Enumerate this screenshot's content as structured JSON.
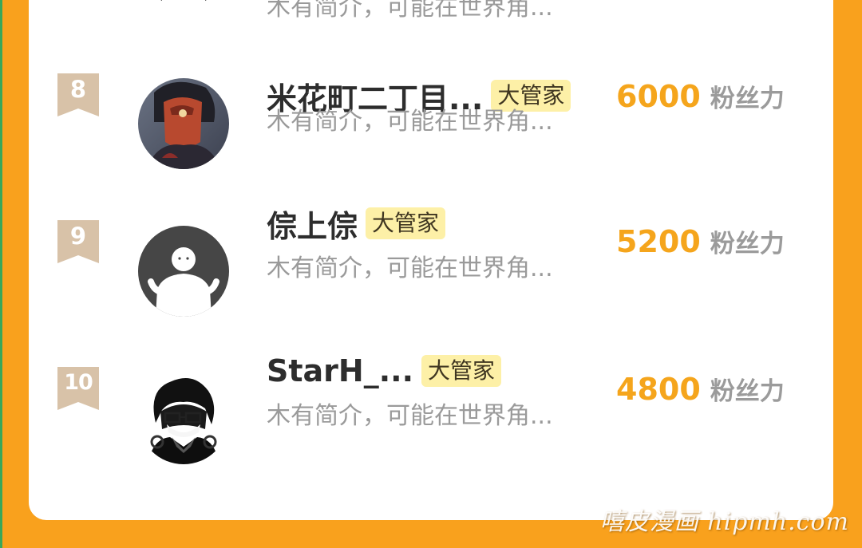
{
  "colors": {
    "page_background": "#f9a11d",
    "card_background": "#ffffff",
    "score_color": "#f5a51c",
    "tag_background": "#fdf0a7",
    "rank_badge": "#d8c2a8"
  },
  "partial_row": {
    "bio": "木有简介，可能在世界角..."
  },
  "rows": [
    {
      "rank": "8",
      "name": "米花町二丁目...",
      "tag": "大管家",
      "bio": "木有简介，可能在世界角...",
      "score": "6000",
      "unit": "粉丝力",
      "avatar": "masked-character-avatar"
    },
    {
      "rank": "9",
      "name": "倧上倧",
      "tag": "大管家",
      "bio": "木有简介，可能在世界角...",
      "score": "5200",
      "unit": "粉丝力",
      "avatar": "default-user-avatar"
    },
    {
      "rank": "10",
      "name": "StarH_...",
      "tag": "大管家",
      "bio": "木有简介，可能在世界角...",
      "score": "4800",
      "unit": "粉丝力",
      "avatar": "anime-glasses-avatar"
    }
  ],
  "watermark": "嘻皮漫画 hipmh.com"
}
